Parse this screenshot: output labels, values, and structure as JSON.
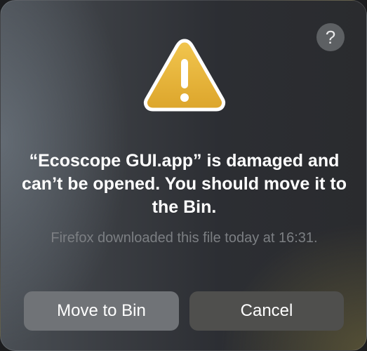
{
  "dialog": {
    "help_label": "?",
    "icon": "warning-triangle-icon",
    "title": "“Ecoscope GUI.app” is damaged and can’t be opened. You should move it to the Bin.",
    "message": "Firefox downloaded this file today at 16:31.",
    "buttons": {
      "move_to_bin": "Move to Bin",
      "cancel": "Cancel"
    }
  },
  "colors": {
    "warning_fill": "#e7b23a",
    "warning_border": "#ffffff",
    "primary_text": "#ffffff",
    "secondary_text": "#7c7f83"
  }
}
